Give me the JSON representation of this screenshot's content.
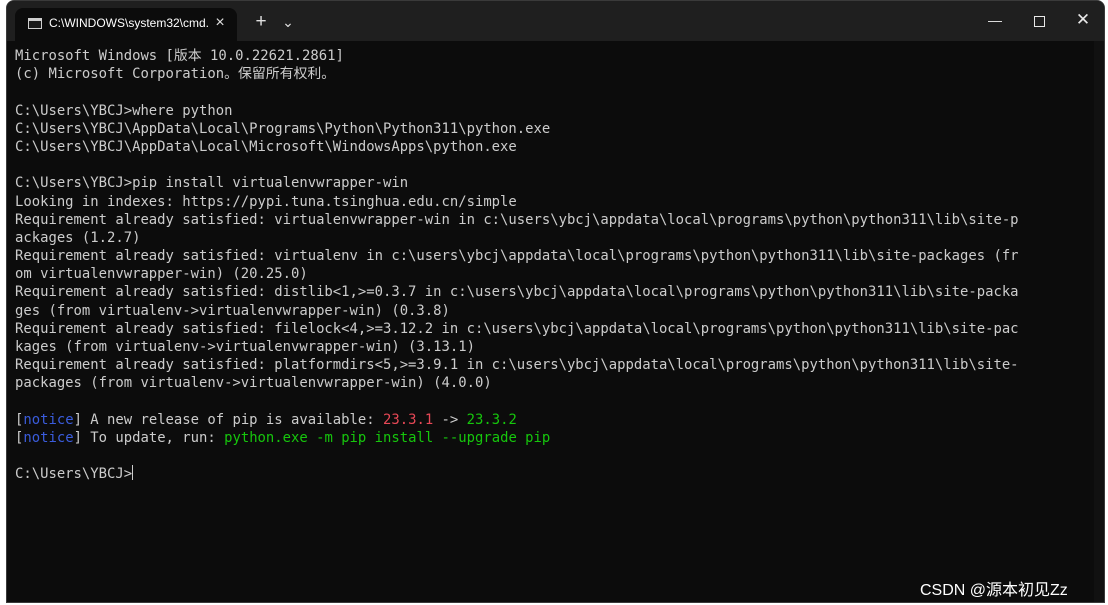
{
  "window": {
    "tab_title": "C:\\WINDOWS\\system32\\cmd.",
    "tab_close": "×",
    "new_tab": "+",
    "dropdown": "⌄",
    "minimize": "—",
    "close": "✕"
  },
  "console": {
    "lines": [
      [
        {
          "text": "Microsoft Windows [版本 10.0.22621.2861]",
          "color": "default"
        }
      ],
      [
        {
          "text": "(c) Microsoft Corporation。保留所有权利。",
          "color": "default"
        }
      ],
      [
        {
          "text": "",
          "color": "default"
        }
      ],
      [
        {
          "text": "C:\\Users\\YBCJ>where python",
          "color": "default"
        }
      ],
      [
        {
          "text": "C:\\Users\\YBCJ\\AppData\\Local\\Programs\\Python\\Python311\\python.exe",
          "color": "default"
        }
      ],
      [
        {
          "text": "C:\\Users\\YBCJ\\AppData\\Local\\Microsoft\\WindowsApps\\python.exe",
          "color": "default"
        }
      ],
      [
        {
          "text": "",
          "color": "default"
        }
      ],
      [
        {
          "text": "C:\\Users\\YBCJ>pip install virtualenvwrapper-win",
          "color": "default"
        }
      ],
      [
        {
          "text": "Looking in indexes: https://pypi.tuna.tsinghua.edu.cn/simple",
          "color": "default"
        }
      ],
      [
        {
          "text": "Requirement already satisfied: virtualenvwrapper-win in c:\\users\\ybcj\\appdata\\local\\programs\\python\\python311\\lib\\site-p",
          "color": "default"
        }
      ],
      [
        {
          "text": "ackages (1.2.7)",
          "color": "default"
        }
      ],
      [
        {
          "text": "Requirement already satisfied: virtualenv in c:\\users\\ybcj\\appdata\\local\\programs\\python\\python311\\lib\\site-packages (fr",
          "color": "default"
        }
      ],
      [
        {
          "text": "om virtualenvwrapper-win) (20.25.0)",
          "color": "default"
        }
      ],
      [
        {
          "text": "Requirement already satisfied: distlib<1,>=0.3.7 in c:\\users\\ybcj\\appdata\\local\\programs\\python\\python311\\lib\\site-packa",
          "color": "default"
        }
      ],
      [
        {
          "text": "ges (from virtualenv->virtualenvwrapper-win) (0.3.8)",
          "color": "default"
        }
      ],
      [
        {
          "text": "Requirement already satisfied: filelock<4,>=3.12.2 in c:\\users\\ybcj\\appdata\\local\\programs\\python\\python311\\lib\\site-pac",
          "color": "default"
        }
      ],
      [
        {
          "text": "kages (from virtualenv->virtualenvwrapper-win) (3.13.1)",
          "color": "default"
        }
      ],
      [
        {
          "text": "Requirement already satisfied: platformdirs<5,>=3.9.1 in c:\\users\\ybcj\\appdata\\local\\programs\\python\\python311\\lib\\site-",
          "color": "default"
        }
      ],
      [
        {
          "text": "packages (from virtualenv->virtualenvwrapper-win) (4.0.0)",
          "color": "default"
        }
      ],
      [
        {
          "text": "",
          "color": "default"
        }
      ],
      [
        {
          "text": "[",
          "color": "default"
        },
        {
          "text": "notice",
          "color": "blue"
        },
        {
          "text": "] A new release of pip is available: ",
          "color": "default"
        },
        {
          "text": "23.3.1",
          "color": "red"
        },
        {
          "text": " -> ",
          "color": "default"
        },
        {
          "text": "23.3.2",
          "color": "green"
        }
      ],
      [
        {
          "text": "[",
          "color": "default"
        },
        {
          "text": "notice",
          "color": "blue"
        },
        {
          "text": "] To update, run: ",
          "color": "default"
        },
        {
          "text": "python.exe -m pip install --upgrade pip",
          "color": "green"
        }
      ],
      [
        {
          "text": "",
          "color": "default"
        }
      ],
      [
        {
          "text": "C:\\Users\\YBCJ>",
          "color": "default",
          "cursor": true
        }
      ]
    ]
  },
  "watermark": "CSDN @源本初见Zz",
  "colors": {
    "background": "#0c0c0c",
    "titlebar": "#1f1f1f",
    "text": "#cccccc",
    "blue": "#3a5cdc",
    "red": "#e74856",
    "green": "#16c60c"
  }
}
